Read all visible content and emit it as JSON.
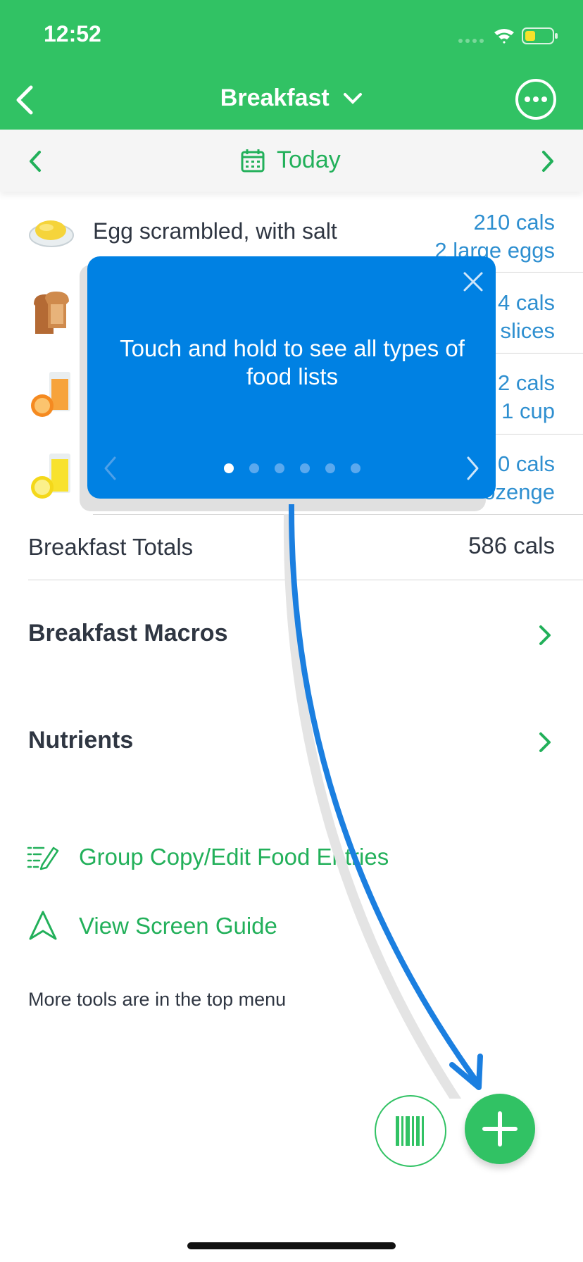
{
  "status_bar": {
    "time": "12:52"
  },
  "nav": {
    "title": "Breakfast"
  },
  "date_bar": {
    "label": "Today"
  },
  "food_items": [
    {
      "name": "Egg scrambled, with salt",
      "cals": "210 cals",
      "serving": "2 large eggs"
    },
    {
      "name": "",
      "cals": "4 cals",
      "serving": "slices"
    },
    {
      "name": "",
      "cals": "2 cals",
      "serving": "1 cup"
    },
    {
      "name": "",
      "cals": "0 cals",
      "serving": "lozenge"
    }
  ],
  "totals": {
    "label": "Breakfast Totals",
    "value": "586 cals"
  },
  "sections": {
    "macros": "Breakfast Macros",
    "nutrients": "Nutrients"
  },
  "links": {
    "group_copy": "Group Copy/Edit Food Entries",
    "screen_guide": "View Screen Guide"
  },
  "footer_note": "More tools are in the top menu",
  "tooltip": {
    "text": "Touch and hold to see all types of food lists",
    "page_count": 6,
    "active_page": 1
  },
  "colors": {
    "brand_green": "#31c264",
    "tooltip_blue": "#0081e3",
    "link_blue": "#2e8fd0"
  }
}
